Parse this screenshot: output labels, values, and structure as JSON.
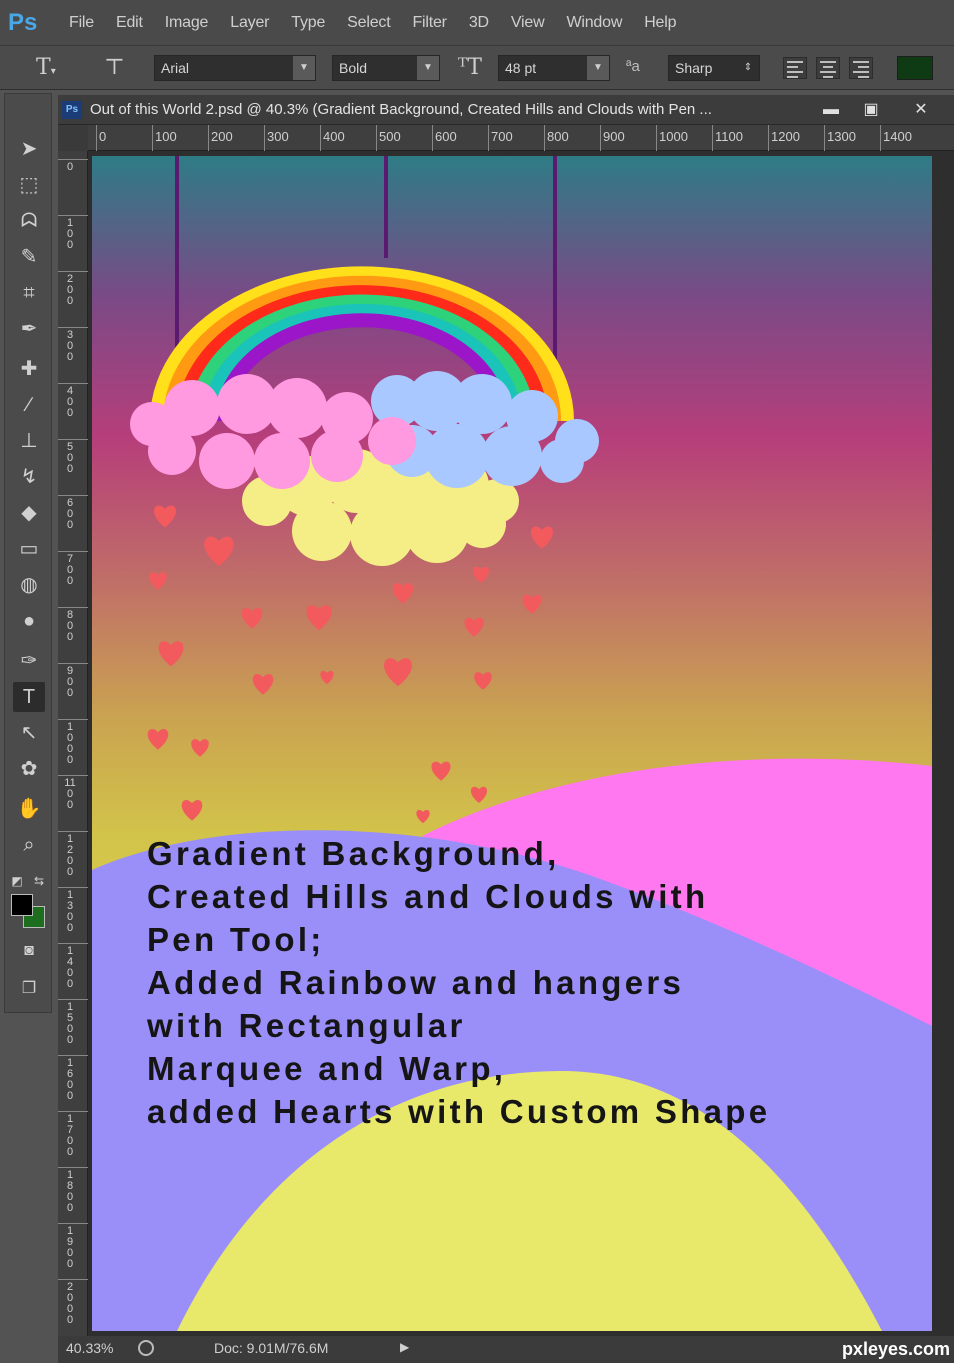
{
  "app": {
    "logo": "Ps"
  },
  "menu": [
    "File",
    "Edit",
    "Image",
    "Layer",
    "Type",
    "Select",
    "Filter",
    "3D",
    "View",
    "Window",
    "Help"
  ],
  "options": {
    "font_family": "Arial",
    "font_style": "Bold",
    "font_size": "48 pt",
    "aa_label": "ªa",
    "anti_alias": "Sharp",
    "text_color": "#0f3b14"
  },
  "document": {
    "title": "Out of this World 2.psd @ 40.3% (Gradient Background, Created Hills and Clouds with Pen ...",
    "ruler_h": [
      "0",
      "100",
      "200",
      "300",
      "400",
      "500",
      "600",
      "700",
      "800",
      "900",
      "1000",
      "1100",
      "1200",
      "1300",
      "1400"
    ],
    "ruler_v": [
      "0",
      "100",
      "200",
      "300",
      "400",
      "500",
      "600",
      "700",
      "800",
      "900",
      "1000",
      "1100",
      "1200",
      "1300",
      "1400",
      "1500",
      "1600",
      "1700",
      "1800",
      "1900",
      "2000"
    ]
  },
  "canvas_text": [
    "Gradient Background,",
    "Created Hills and Clouds with",
    "Pen Tool;",
    "Added Rainbow and hangers",
    "with Rectangular",
    "Marquee and Warp,",
    "added Hearts with Custom Shape"
  ],
  "colors": {
    "rainbow": [
      "#ffe01a",
      "#ff9a12",
      "#ff2a1a",
      "#2ed27a",
      "#1bc4b8",
      "#9a16c8"
    ],
    "cloud_pink": "#ff99e0",
    "cloud_blue": "#a9c8ff",
    "cloud_yellow": "#f5ee86",
    "heart": "#f25a5e",
    "hill_pink": "#ff78f0",
    "hill_purple": "#9a8ef8",
    "hill_yellow": "#e8e86a",
    "hanger": "#5a1a70"
  },
  "status": {
    "zoom": "40.33%",
    "doc": "Doc: 9.01M/76.6M"
  },
  "watermark": "pxleyes.com"
}
